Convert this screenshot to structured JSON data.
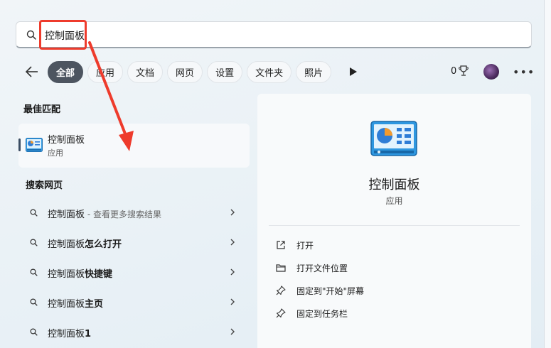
{
  "search": {
    "value": "控制面板"
  },
  "filters": {
    "items": [
      "全部",
      "应用",
      "文档",
      "网页",
      "设置",
      "文件夹",
      "照片"
    ],
    "active_index": 0
  },
  "header_right": {
    "points": "0"
  },
  "best_match": {
    "section_title": "最佳匹配",
    "name": "控制面板",
    "type": "应用"
  },
  "web_search": {
    "section_title": "搜索网页",
    "items": [
      {
        "query": "控制面板",
        "suffix": " - 查看更多搜索结果"
      },
      {
        "query": "控制面板",
        "bold": "怎么打开"
      },
      {
        "query": "控制面板",
        "bold": "快捷键"
      },
      {
        "query": "控制面板",
        "bold": "主页"
      },
      {
        "query": "控制面板",
        "bold": "1"
      }
    ]
  },
  "detail": {
    "title": "控制面板",
    "subtitle": "应用",
    "actions": [
      {
        "label": "打开",
        "icon": "open-external-icon"
      },
      {
        "label": "打开文件位置",
        "icon": "folder-icon"
      },
      {
        "label": "固定到\"开始\"屏幕",
        "icon": "pin-icon"
      },
      {
        "label": "固定到任务栏",
        "icon": "pin-icon"
      }
    ]
  },
  "colors": {
    "annotation_red": "#ee3b2c",
    "active_chip": "#4d5560"
  }
}
